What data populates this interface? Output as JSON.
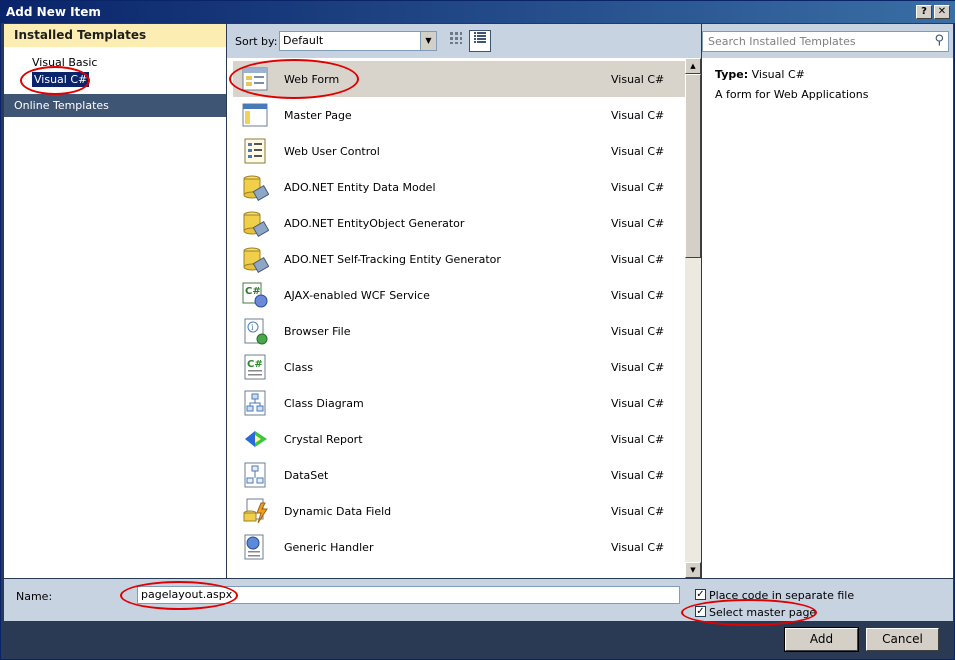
{
  "window": {
    "title": "Add New Item",
    "help_label": "?",
    "close_label": "✕"
  },
  "left": {
    "installed_heading": "Installed Templates",
    "tree": [
      {
        "label": "Visual Basic",
        "selected": false
      },
      {
        "label": "Visual C#",
        "selected": true
      }
    ],
    "online_heading": "Online Templates"
  },
  "toolbar": {
    "sort_label": "Sort by:",
    "sort_value": "Default"
  },
  "search": {
    "placeholder": "Search Installed Templates"
  },
  "templates": [
    {
      "name": "Web Form",
      "lang": "Visual C#",
      "icon": "web-form-icon",
      "selected": true
    },
    {
      "name": "Master Page",
      "lang": "Visual C#",
      "icon": "master-page-icon"
    },
    {
      "name": "Web User Control",
      "lang": "Visual C#",
      "icon": "web-user-control-icon"
    },
    {
      "name": "ADO.NET Entity Data Model",
      "lang": "Visual C#",
      "icon": "database-icon"
    },
    {
      "name": "ADO.NET EntityObject Generator",
      "lang": "Visual C#",
      "icon": "database-icon"
    },
    {
      "name": "ADO.NET Self-Tracking Entity Generator",
      "lang": "Visual C#",
      "icon": "database-icon"
    },
    {
      "name": "AJAX-enabled WCF Service",
      "lang": "Visual C#",
      "icon": "wcf-service-icon"
    },
    {
      "name": "Browser File",
      "lang": "Visual C#",
      "icon": "browser-file-icon"
    },
    {
      "name": "Class",
      "lang": "Visual C#",
      "icon": "class-icon"
    },
    {
      "name": "Class Diagram",
      "lang": "Visual C#",
      "icon": "class-diagram-icon"
    },
    {
      "name": "Crystal Report",
      "lang": "Visual C#",
      "icon": "crystal-report-icon"
    },
    {
      "name": "DataSet",
      "lang": "Visual C#",
      "icon": "dataset-icon"
    },
    {
      "name": "Dynamic Data Field",
      "lang": "Visual C#",
      "icon": "dynamic-data-field-icon"
    },
    {
      "name": "Generic Handler",
      "lang": "Visual C#",
      "icon": "generic-handler-icon"
    }
  ],
  "details": {
    "type_label": "Type:",
    "type_value": "Visual C#",
    "description": "A form for Web Applications"
  },
  "bottom": {
    "name_label": "Name:",
    "name_value": "pagelayout.aspx",
    "place_code_label": "Place code in separate file",
    "place_code_checked": true,
    "master_page_label": "Select master page",
    "master_page_checked": true
  },
  "buttons": {
    "add": "Add",
    "cancel": "Cancel"
  },
  "colors": {
    "annotation": "#e00000",
    "selection": "#0a246a",
    "heading_bg": "#fceeb2",
    "frame": "#2b3a54"
  }
}
